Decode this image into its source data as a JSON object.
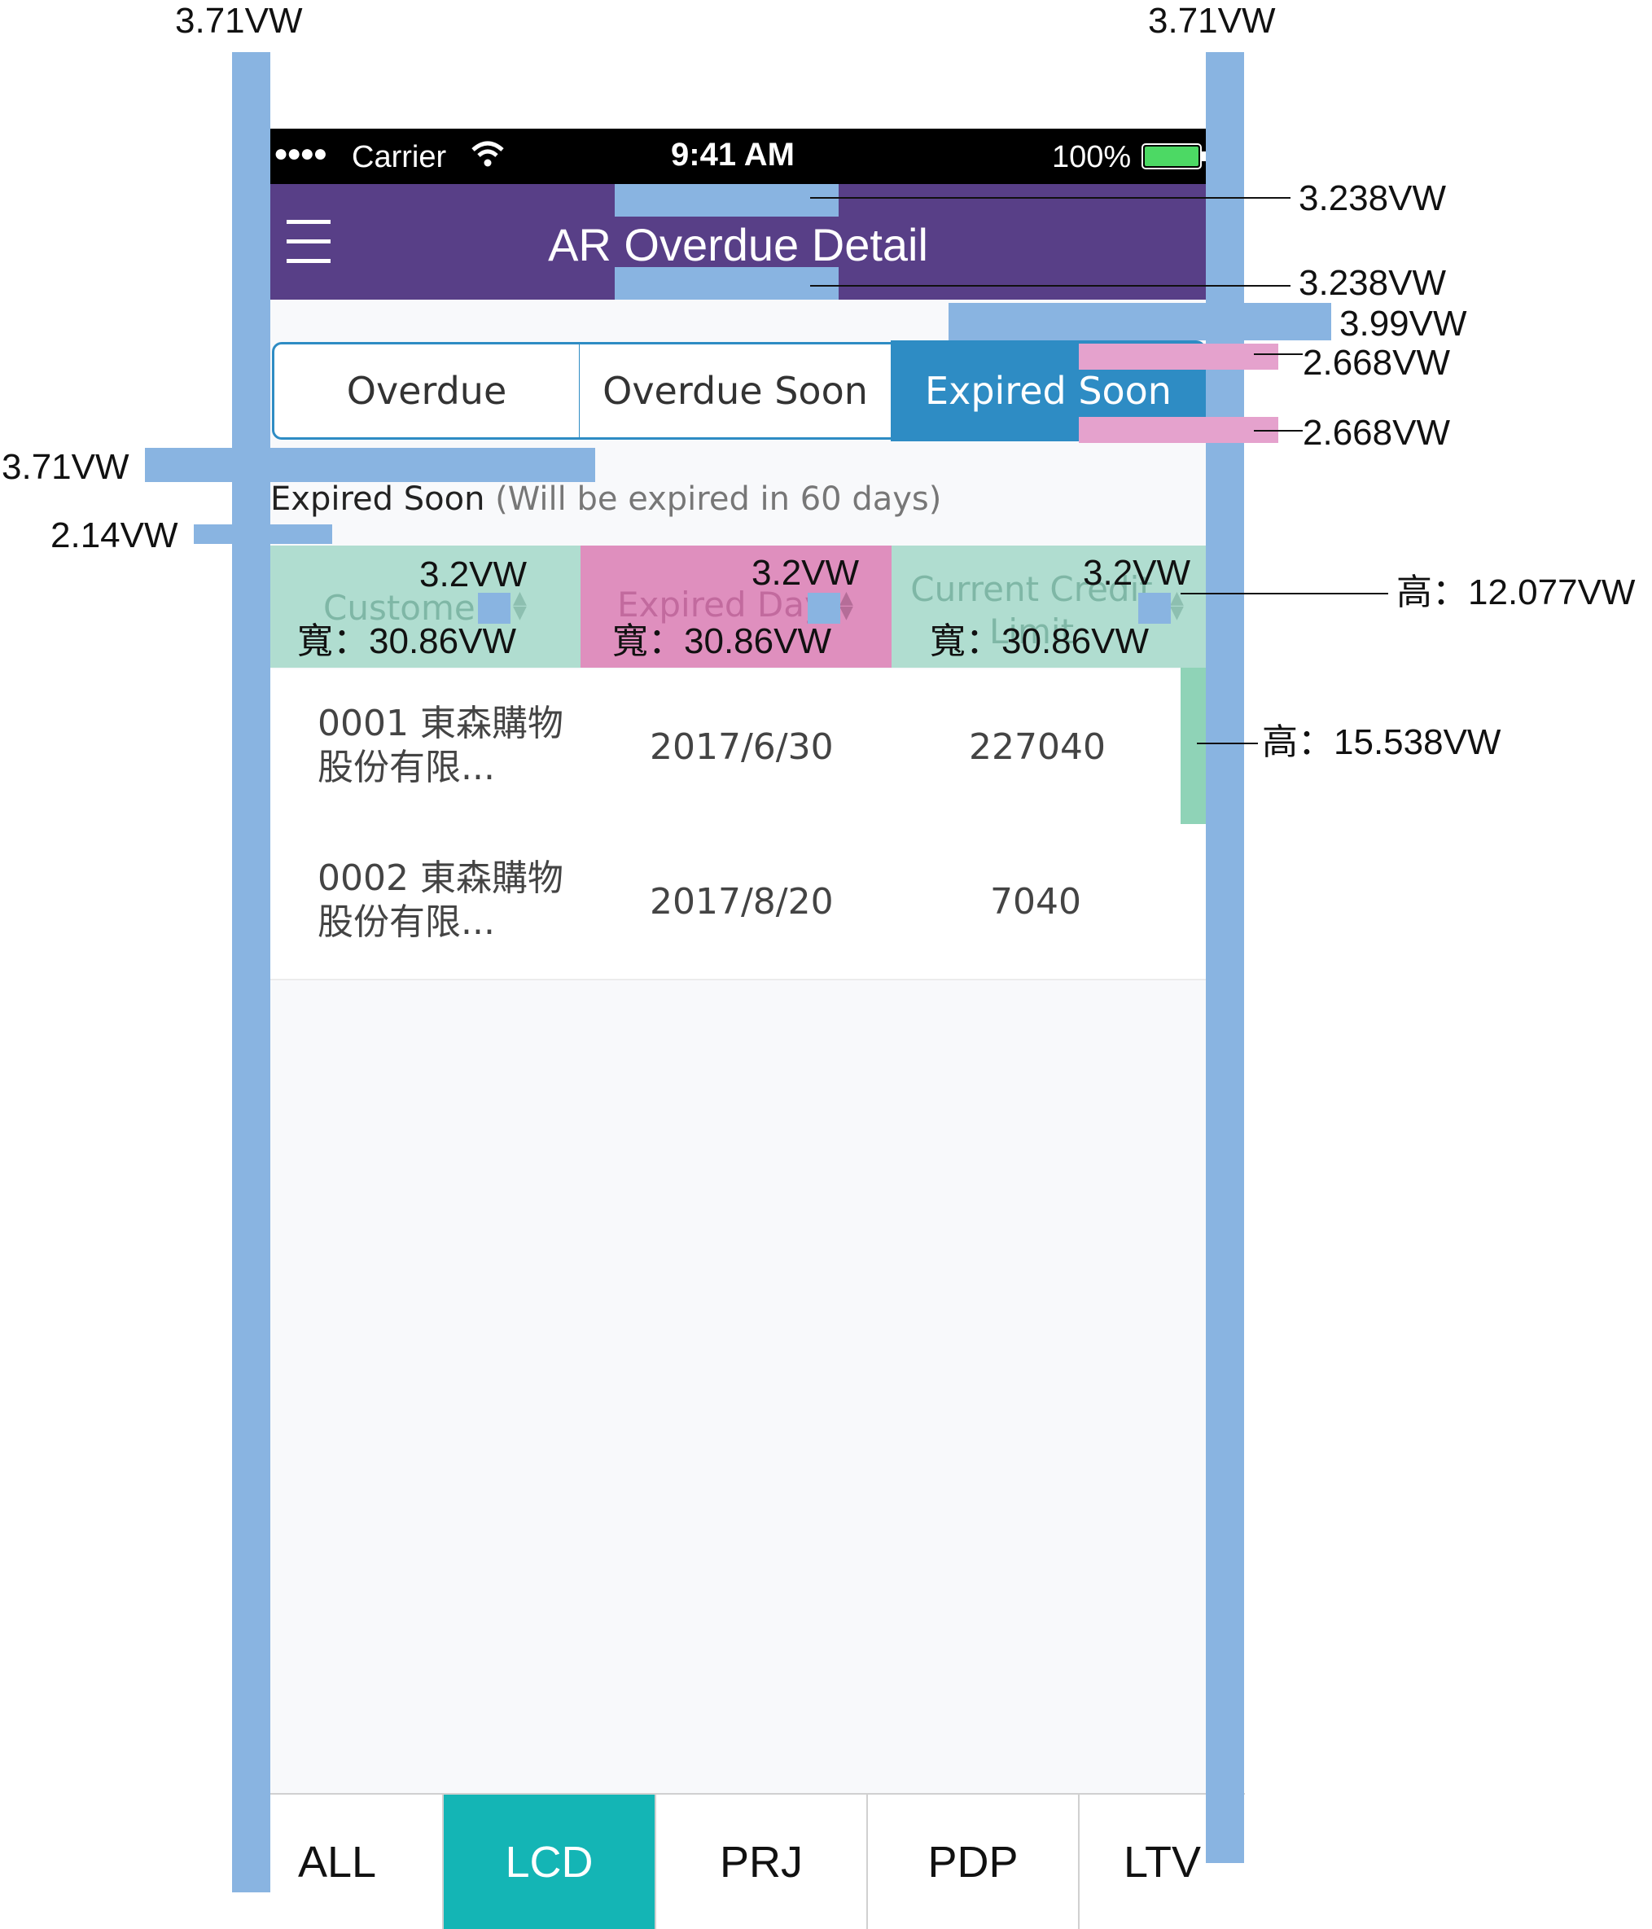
{
  "status_bar": {
    "carrier": "Carrier",
    "time": "9:41 AM",
    "battery": "100%"
  },
  "header": {
    "title": "AR Overdue Detail",
    "menu_icon": "hamburger-icon"
  },
  "segments": [
    {
      "label": "Overdue",
      "active": false
    },
    {
      "label": "Overdue Soon",
      "active": false
    },
    {
      "label": "Expired Soon",
      "active": true
    }
  ],
  "section": {
    "title": "Expired Soon",
    "subtitle": "(Will be expired in 60 days)"
  },
  "table": {
    "columns": [
      {
        "label": "Customer",
        "color": "#b0ddd0"
      },
      {
        "label": "Expired Day",
        "color": "#df8fbe"
      },
      {
        "label": "Current Credit Limit",
        "color": "#b0ddd0"
      }
    ],
    "rows": [
      {
        "customer_line1": "0001 東森購物",
        "customer_line2": "股份有限...",
        "expired_day": "2017/6/30",
        "credit_limit": "227040"
      },
      {
        "customer_line1": "0002 東森購物",
        "customer_line2": "股份有限...",
        "expired_day": "2017/8/20",
        "credit_limit": "7040"
      }
    ]
  },
  "tabs": [
    {
      "label": "ALL",
      "active": false
    },
    {
      "label": "LCD",
      "active": true
    },
    {
      "label": "PRJ",
      "active": false
    },
    {
      "label": "PDP",
      "active": false
    },
    {
      "label": "LTV",
      "active": false
    }
  ],
  "annotations": {
    "margin_left": "3.71VW",
    "margin_right": "3.71VW",
    "header_pad_top": "3.238VW",
    "header_pad_bottom": "3.238VW",
    "segment_gap": "3.99VW",
    "segment_pad_top": "2.668VW",
    "segment_pad_bottom": "2.668VW",
    "section_gap": "3.71VW",
    "section_pad": "2.14VW",
    "sort_icon_1": "3.2VW",
    "sort_icon_2": "3.2VW",
    "sort_icon_3": "3.2VW",
    "col_width_1": "寬：30.86VW",
    "col_width_2": "寬：30.86VW",
    "col_width_3": "寬：30.86VW",
    "header_height": "高：12.077VW",
    "row_height": "高：15.538VW"
  },
  "colors": {
    "header": "#583f87",
    "segment_active": "#2e8cc4",
    "tab_active": "#14b5b5",
    "annotation_blue": "#89b4e1",
    "annotation_pink": "#e5a2cd"
  }
}
